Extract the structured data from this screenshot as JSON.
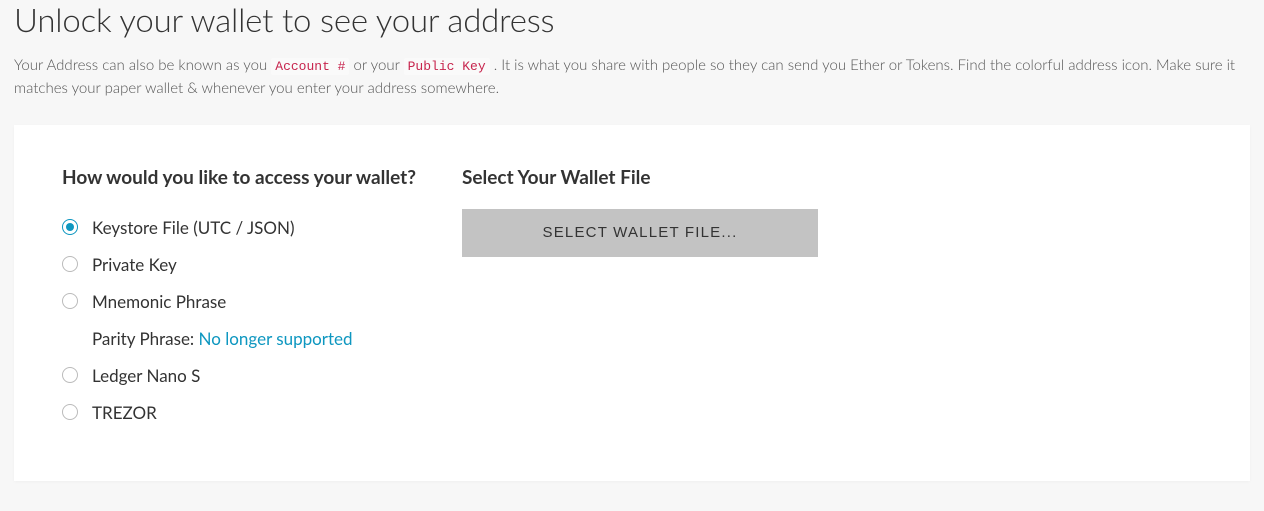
{
  "header": {
    "title": "Unlock your wallet to see your address",
    "intro_part1": "Your Address can also be known as you ",
    "code1": "Account #",
    "intro_part2": " or your ",
    "code2": "Public Key",
    "intro_part3": " . It is what you share with people so they can send you Ether or Tokens. Find the colorful address icon. Make sure it matches your paper wallet & whenever you enter your address somewhere."
  },
  "left": {
    "heading": "How would you like to access your wallet?",
    "options": [
      {
        "label": "Keystore File (UTC / JSON)",
        "selected": true
      },
      {
        "label": "Private Key",
        "selected": false
      },
      {
        "label": "Mnemonic Phrase",
        "selected": false
      },
      {
        "label_prefix": "Parity Phrase: ",
        "link_text": "No longer supported",
        "noinput": true
      },
      {
        "label": "Ledger Nano S",
        "selected": false
      },
      {
        "label": "TREZOR",
        "selected": false
      }
    ]
  },
  "right": {
    "heading": "Select Your Wallet File",
    "button": "SELECT WALLET FILE..."
  }
}
